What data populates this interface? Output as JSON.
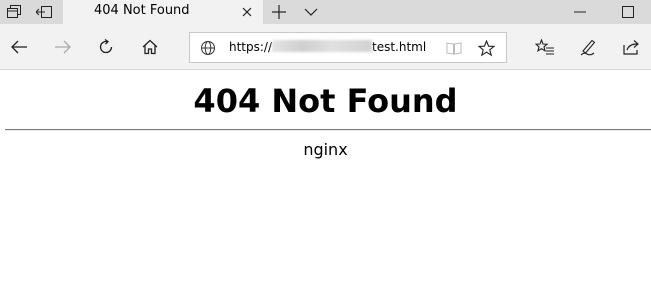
{
  "tab": {
    "title": "404 Not Found"
  },
  "address": {
    "prefix": "https://",
    "suffix": "test.html"
  },
  "page": {
    "heading": "404 Not Found",
    "server": "nginx"
  },
  "icons": {
    "tab_manager": "tab-manager-icon",
    "set_aside_tabs": "set-aside-tabs-icon",
    "close_tab": "close-icon",
    "new_tab": "plus-icon",
    "tab_preview": "chevron-down-icon",
    "minimize": "minimize-icon",
    "maximize": "maximize-icon",
    "back": "back-arrow-icon",
    "forward": "forward-arrow-icon",
    "refresh": "refresh-icon",
    "home": "home-icon",
    "globe": "globe-icon",
    "reading_view": "reading-view-icon",
    "favorite": "star-icon",
    "favorites_hub": "favorites-hub-icon",
    "web_note": "pen-icon",
    "share": "share-icon"
  },
  "colors": {
    "tab_strip": "#dadada",
    "toolbar": "#f2f2f2",
    "page_background": "#ffffff"
  }
}
